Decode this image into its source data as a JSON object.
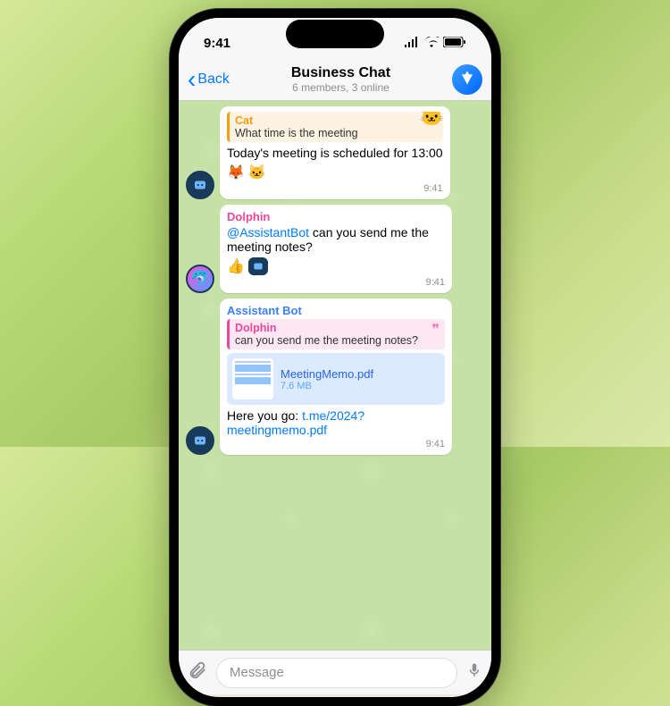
{
  "status": {
    "time": "9:41"
  },
  "header": {
    "back": "Back",
    "title": "Business Chat",
    "subtitle": "6 members, 3 online"
  },
  "messages": [
    {
      "reply": {
        "name": "Cat",
        "text": "What time is the meeting"
      },
      "text": "Today's meeting is scheduled for 13:00",
      "reactions": [
        "🦊",
        "🐱"
      ],
      "time": "9:41"
    },
    {
      "sender": "Dolphin",
      "mention": "@AssistantBot",
      "text": " can you send me the meeting notes?",
      "reactions": [
        "👍"
      ],
      "time": "9:41"
    },
    {
      "sender": "Assistant Bot",
      "reply": {
        "name": "Dolphin",
        "text": "can you send me the meeting notes?"
      },
      "file": {
        "name": "MeetingMemo.pdf",
        "size": "7.6 MB"
      },
      "text_pre": "Here you go: ",
      "link": "t.me/2024?meetingmemo.pdf",
      "time": "9:41"
    }
  ],
  "input": {
    "placeholder": "Message"
  }
}
